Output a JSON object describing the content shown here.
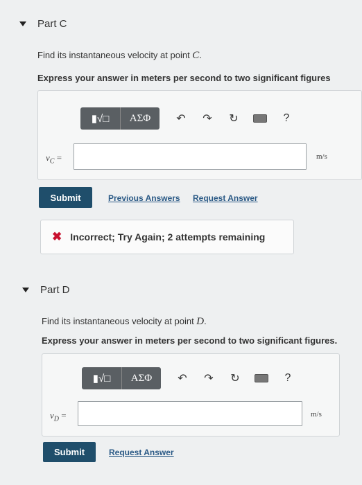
{
  "part_c": {
    "title": "Part C",
    "question_prefix": "Find its instantaneous velocity at point ",
    "question_point": "C",
    "question_suffix": ".",
    "instruction": "Express your answer in meters per second to two significant figures",
    "toolbar": {
      "templates": "▮√□",
      "symbols": "ΑΣΦ",
      "undo": "↶",
      "redo": "↷",
      "reset": "↻",
      "help": "?"
    },
    "input_label": "v",
    "input_label_sub": "C",
    "input_label_eq": " =",
    "input_value": "",
    "unit": "m/s",
    "submit": "Submit",
    "previous_answers": "Previous Answers",
    "request_answer": "Request Answer",
    "feedback": "Incorrect; Try Again; 2 attempts remaining",
    "feedback_icon": "✖"
  },
  "part_d": {
    "title": "Part D",
    "question_prefix": "Find its instantaneous velocity at point ",
    "question_point": "D",
    "question_suffix": ".",
    "instruction": "Express your answer in meters per second to two significant figures.",
    "toolbar": {
      "templates": "▮√□",
      "symbols": "ΑΣΦ",
      "undo": "↶",
      "redo": "↷",
      "reset": "↻",
      "help": "?"
    },
    "input_label": "v",
    "input_label_sub": "D",
    "input_label_eq": " =",
    "input_value": "",
    "unit": "m/s",
    "submit": "Submit",
    "request_answer": "Request Answer"
  },
  "colors": {
    "submit_bg": "#1f4e6b",
    "link": "#2b5a86",
    "error_icon": "#c8102e"
  }
}
